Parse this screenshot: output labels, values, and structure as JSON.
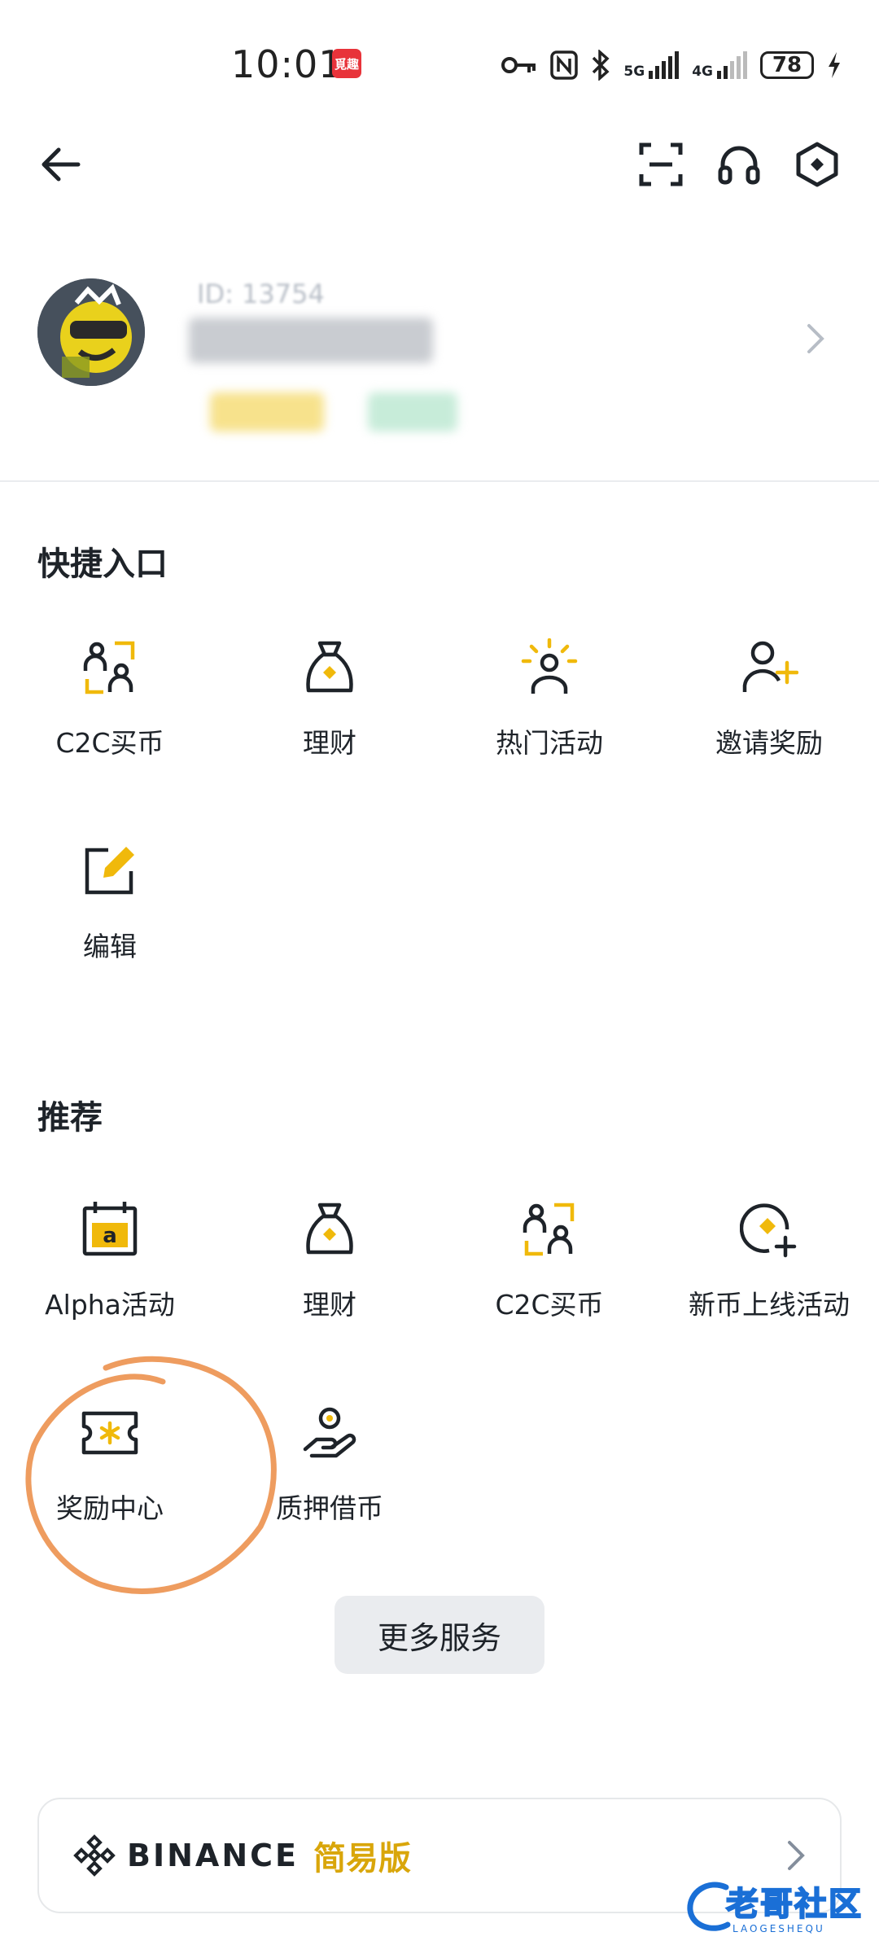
{
  "status_bar": {
    "time": "10:01",
    "app_badge": "覓趣",
    "signal_5g": "5G",
    "signal_4g": "4G",
    "battery": "78"
  },
  "header": {
    "back_icon": "arrow-left-icon",
    "scan_icon": "scan-icon",
    "support_icon": "headset-icon",
    "settings_icon": "hexagon-settings-icon"
  },
  "profile": {
    "id_prefix": "ID: 13754"
  },
  "quick_entry": {
    "title": "快捷入口",
    "items": [
      {
        "label": "C2C买币",
        "icon": "c2c-users-icon"
      },
      {
        "label": "理财",
        "icon": "money-bag-icon"
      },
      {
        "label": "热门活动",
        "icon": "hot-activity-icon"
      },
      {
        "label": "邀请奖励",
        "icon": "invite-user-icon"
      },
      {
        "label": "编辑",
        "icon": "edit-icon"
      }
    ]
  },
  "recommend": {
    "title": "推荐",
    "items": [
      {
        "label": "Alpha活动",
        "icon": "alpha-calendar-icon"
      },
      {
        "label": "理财",
        "icon": "money-bag-icon"
      },
      {
        "label": "C2C买币",
        "icon": "c2c-users-icon"
      },
      {
        "label": "新币上线活动",
        "icon": "new-coin-icon"
      },
      {
        "label": "奖励中心",
        "icon": "reward-ticket-icon"
      },
      {
        "label": "质押借币",
        "icon": "loan-hand-icon"
      }
    ]
  },
  "more_services": "更多服务",
  "lite": {
    "brand": "BINANCE",
    "edition": "简易版"
  },
  "watermark": {
    "title": "老哥社区",
    "subtitle": "LAOGESHEQU"
  },
  "colors": {
    "brand_yellow": "#f0b90b",
    "annotation_orange": "#ee9c5f"
  }
}
